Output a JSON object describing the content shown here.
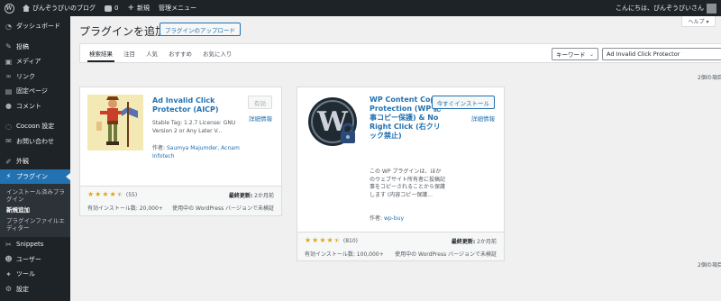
{
  "admin_bar": {
    "site_name": "ぴんぞうぴいのブログ",
    "comments_count": "0",
    "new_label": "新規",
    "manage_menu": "管理メニュー",
    "greeting": "こんにちは、ぴんぞうぴいさん"
  },
  "sidebar": {
    "items": [
      {
        "label": "ダッシュボード",
        "icon": "dashboard-icon"
      },
      {
        "label": "投稿",
        "icon": "pin-icon"
      },
      {
        "label": "メディア",
        "icon": "media-icon"
      },
      {
        "label": "リンク",
        "icon": "link-icon"
      },
      {
        "label": "固定ページ",
        "icon": "page-icon"
      },
      {
        "label": "コメント",
        "icon": "comment-icon"
      },
      {
        "label": "Cocoon 設定",
        "icon": "cocoon-icon"
      },
      {
        "label": "お問い合わせ",
        "icon": "mail-icon"
      },
      {
        "label": "外観",
        "icon": "brush-icon"
      },
      {
        "label": "プラグイン",
        "icon": "plugin-icon"
      },
      {
        "label": "Snippets",
        "icon": "snippets-icon"
      },
      {
        "label": "ユーザー",
        "icon": "user-icon"
      },
      {
        "label": "ツール",
        "icon": "wrench-icon"
      },
      {
        "label": "設定",
        "icon": "settings-icon"
      }
    ],
    "submenu": [
      "インストール済みプラグイン",
      "新規追加",
      "プラグインファイルエディター"
    ]
  },
  "header": {
    "title": "プラグインを追加",
    "upload_button": "プラグインのアップロード",
    "help": "ヘルプ ▾"
  },
  "filter": {
    "tabs": [
      "検索結果",
      "注目",
      "人気",
      "おすすめ",
      "お気に入り"
    ],
    "search_type": "キーワード",
    "search_value": "Ad Invalid Click Protector"
  },
  "count_top": "2個の項目",
  "count_bottom": "2個の項目",
  "plugins": [
    {
      "name": "Ad Invalid Click Protector (AICP)",
      "action": "有効",
      "details": "詳細情報",
      "description": "Stable Tag: 1.2.7 License: GNU Version 2 or Any Later V...",
      "author_label": "作者:",
      "author": "Saumya Majumder, Acnam Infotech",
      "rating": 4.5,
      "rating_count": "(55)",
      "last_updated_label": "最終更新:",
      "last_updated": "2か月前",
      "installs": "有効インストール数: 20,000+",
      "compat": "使用中の WordPress バージョンで未検証"
    },
    {
      "name": "WP Content Copy Protection (WP 記事コピー保護) & No Right Click (右クリック禁止)",
      "action": "今すぐインストール",
      "details": "詳細情報",
      "description": "この WP プラグインは、ほかのウェブサイト所有者に投稿記事をコピーされることから保護します (内容コピー保護...",
      "author_label": "作者:",
      "author": "wp-buy",
      "rating": 4.5,
      "rating_count": "(810)",
      "last_updated_label": "最終更新:",
      "last_updated": "2か月前",
      "installs": "有効インストール数: 100,000+",
      "compat": "使用中の WordPress バージョンで未検証"
    }
  ],
  "colors": {
    "admin_bg": "#1d2327",
    "accent": "#2271b1",
    "star": "#dba617",
    "page_bg": "#f0f0f1"
  }
}
